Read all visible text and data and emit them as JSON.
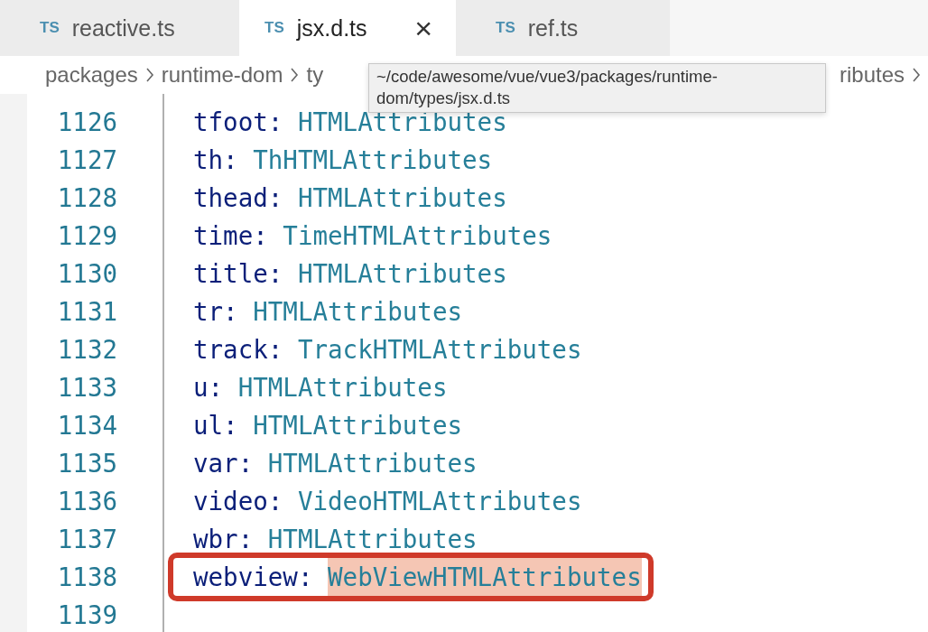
{
  "tabs": [
    {
      "badge": "TS",
      "label": "reactive.ts",
      "selected": false
    },
    {
      "badge": "TS",
      "label": "jsx.d.ts",
      "selected": true,
      "close": "×"
    },
    {
      "badge": "TS",
      "label": "ref.ts",
      "selected": false
    }
  ],
  "breadcrumb": {
    "items": [
      "packages",
      "runtime-dom",
      "ty"
    ],
    "tail": "ributes"
  },
  "tooltip": {
    "text": "~/code/awesome/vue/vue3/packages/runtime-dom/types/jsx.d.ts"
  },
  "lines": [
    {
      "number": "1126",
      "key": "tfoot:",
      "type": "HTMLAttributes",
      "highlighted": false
    },
    {
      "number": "1127",
      "key": "th:",
      "type": "ThHTMLAttributes",
      "highlighted": false
    },
    {
      "number": "1128",
      "key": "thead:",
      "type": "HTMLAttributes",
      "highlighted": false
    },
    {
      "number": "1129",
      "key": "time:",
      "type": "TimeHTMLAttributes",
      "highlighted": false
    },
    {
      "number": "1130",
      "key": "title:",
      "type": "HTMLAttributes",
      "highlighted": false
    },
    {
      "number": "1131",
      "key": "tr:",
      "type": "HTMLAttributes",
      "highlighted": false
    },
    {
      "number": "1132",
      "key": "track:",
      "type": "TrackHTMLAttributes",
      "highlighted": false
    },
    {
      "number": "1133",
      "key": "u:",
      "type": "HTMLAttributes",
      "highlighted": false
    },
    {
      "number": "1134",
      "key": "ul:",
      "type": "HTMLAttributes",
      "highlighted": false
    },
    {
      "number": "1135",
      "key": "var:",
      "type": "HTMLAttributes",
      "highlighted": false
    },
    {
      "number": "1136",
      "key": "video:",
      "type": "VideoHTMLAttributes",
      "highlighted": false
    },
    {
      "number": "1137",
      "key": "wbr:",
      "type": "HTMLAttributes",
      "highlighted": false
    },
    {
      "number": "1138",
      "key": "webview:",
      "type": "WebViewHTMLAttributes",
      "highlighted": true
    },
    {
      "number": "1139"
    }
  ]
}
